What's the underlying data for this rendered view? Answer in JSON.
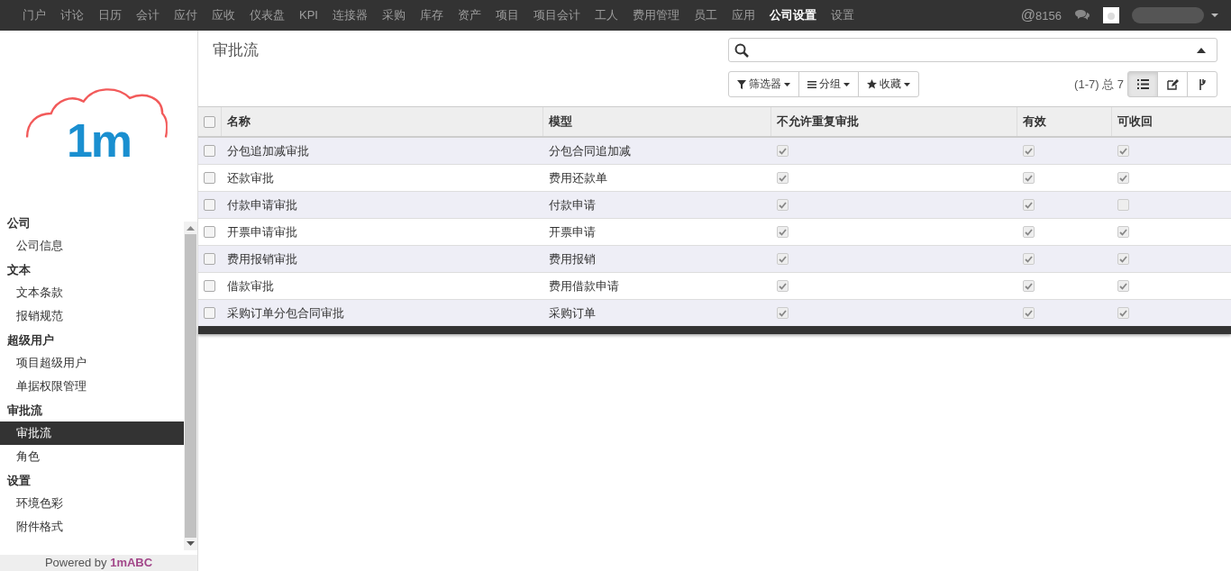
{
  "top_menu": [
    {
      "label": "门户",
      "selected": false
    },
    {
      "label": "讨论",
      "selected": false
    },
    {
      "label": "日历",
      "selected": false
    },
    {
      "label": "会计",
      "selected": false
    },
    {
      "label": "应付",
      "selected": false
    },
    {
      "label": "应收",
      "selected": false
    },
    {
      "label": "仪表盘",
      "selected": false
    },
    {
      "label": "KPI",
      "selected": false
    },
    {
      "label": "连接器",
      "selected": false
    },
    {
      "label": "采购",
      "selected": false
    },
    {
      "label": "库存",
      "selected": false
    },
    {
      "label": "资产",
      "selected": false
    },
    {
      "label": "项目",
      "selected": false
    },
    {
      "label": "项目会计",
      "selected": false
    },
    {
      "label": "工人",
      "selected": false
    },
    {
      "label": "费用管理",
      "selected": false
    },
    {
      "label": "员工",
      "selected": false
    },
    {
      "label": "应用",
      "selected": false
    },
    {
      "label": "公司设置",
      "selected": true
    },
    {
      "label": "设置",
      "selected": false
    }
  ],
  "notifications": {
    "at": "@",
    "count": "8156"
  },
  "logo": {
    "text": "1m"
  },
  "sidebar": {
    "sections": [
      {
        "title": "公司",
        "items": [
          {
            "label": "公司信息",
            "selected": false
          }
        ]
      },
      {
        "title": "文本",
        "items": [
          {
            "label": "文本条款",
            "selected": false
          },
          {
            "label": "报销规范",
            "selected": false
          }
        ]
      },
      {
        "title": "超级用户",
        "items": [
          {
            "label": "项目超级用户",
            "selected": false
          },
          {
            "label": "单据权限管理",
            "selected": false
          }
        ]
      },
      {
        "title": "审批流",
        "items": [
          {
            "label": "审批流",
            "selected": true
          },
          {
            "label": "角色",
            "selected": false
          }
        ]
      },
      {
        "title": "设置",
        "items": [
          {
            "label": "环境色彩",
            "selected": false
          },
          {
            "label": "附件格式",
            "selected": false
          }
        ]
      }
    ]
  },
  "footer": {
    "prefix": "Powered by",
    "brand": "1mABC"
  },
  "page_title": "审批流",
  "filters": [
    {
      "label": "筛选器",
      "kind": "filter"
    },
    {
      "label": "分组",
      "kind": "group"
    },
    {
      "label": "收藏",
      "kind": "favorite"
    }
  ],
  "pager": "(1-7) 总 7",
  "views": [
    {
      "kind": "list",
      "selected": true
    },
    {
      "kind": "form",
      "selected": false
    },
    {
      "kind": "pivot",
      "selected": false
    }
  ],
  "table": {
    "all_selected": false,
    "columns": [
      "名称",
      "模型",
      "不允许重复审批",
      "有效",
      "可收回"
    ],
    "rows": [
      {
        "selected": false,
        "name": "分包追加减审批",
        "model": "分包合同追加减",
        "no_repeat": true,
        "active": true,
        "recallable": true
      },
      {
        "selected": false,
        "name": "还款审批",
        "model": "费用还款单",
        "no_repeat": true,
        "active": true,
        "recallable": true
      },
      {
        "selected": false,
        "name": "付款申请审批",
        "model": "付款申请",
        "no_repeat": true,
        "active": true,
        "recallable": false
      },
      {
        "selected": false,
        "name": "开票申请审批",
        "model": "开票申请",
        "no_repeat": true,
        "active": true,
        "recallable": true
      },
      {
        "selected": false,
        "name": "费用报销审批",
        "model": "费用报销",
        "no_repeat": true,
        "active": true,
        "recallable": true
      },
      {
        "selected": false,
        "name": "借款审批",
        "model": "费用借款申请",
        "no_repeat": true,
        "active": true,
        "recallable": true
      },
      {
        "selected": false,
        "name": "采购订单分包合同审批",
        "model": "采购订单",
        "no_repeat": true,
        "active": true,
        "recallable": true
      }
    ]
  }
}
